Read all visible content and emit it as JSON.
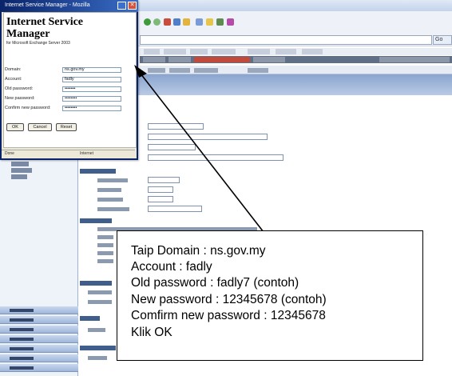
{
  "dialog": {
    "window_title": "Internet Service Manager - Mozilla",
    "heading": "Internet Service Manager",
    "subtitle": "for Microsoft Exchange Server 2003",
    "fields": [
      {
        "label": "Domain:",
        "value": "ns.gov.my"
      },
      {
        "label": "Account:",
        "value": "fadly"
      },
      {
        "label": "Old password:",
        "value": "•••••••"
      },
      {
        "label": "New password:",
        "value": "••••••••"
      },
      {
        "label": "Confirm new password:",
        "value": "••••••••"
      }
    ],
    "buttons": {
      "ok": "OK",
      "cancel": "Cancel",
      "reset": "Reset"
    },
    "status_left": "Done",
    "status_right": "Internet"
  },
  "browser": {
    "go_label": "Go"
  },
  "annotation": {
    "lines": [
      "Taip Domain : ns.gov.my",
      " Account : fadly",
      "Old password : fadly7 (contoh)",
      "New password : 12345678 (contoh)",
      "Comfirm new password : 12345678",
      "Klik OK"
    ]
  },
  "colors": {
    "dialog_title": "#0a246a",
    "owa_header": "#8aa5cf",
    "arrow": "#000000"
  }
}
